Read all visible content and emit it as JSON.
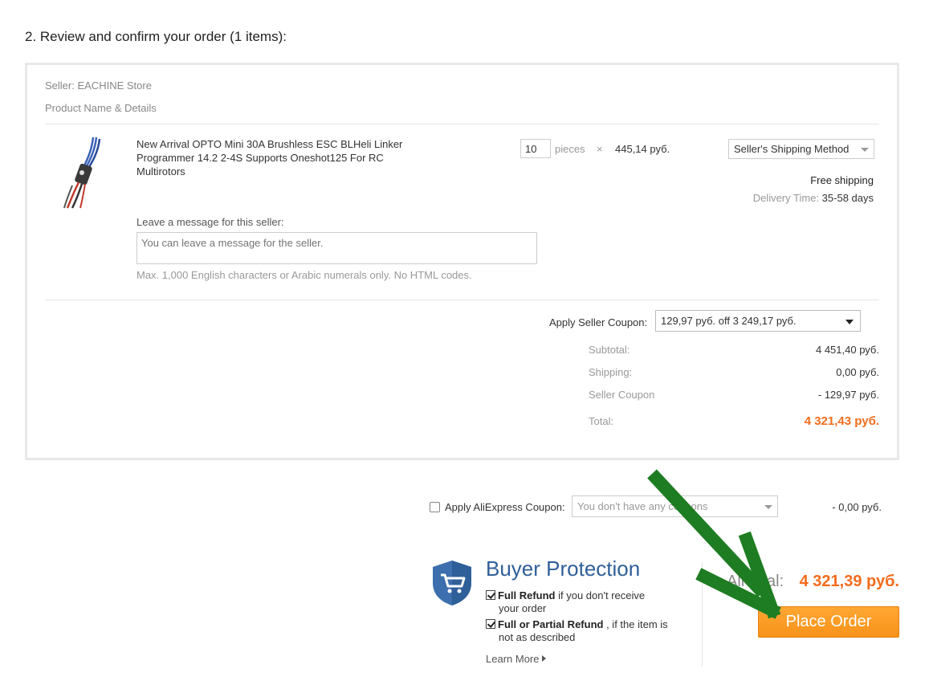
{
  "section_title": "2. Review and confirm your order (1 items):",
  "seller": {
    "label": "Seller: EACHINE Store",
    "product_header": "Product Name & Details"
  },
  "product": {
    "name": "New Arrival OPTO Mini 30A Brushless ESC BLHeli Linker Programmer 14.2 2-4S Supports Oneshot125 For RC Multirotors",
    "quantity": "10",
    "unit": "pieces",
    "times": "×",
    "unit_price": "445,14 руб.",
    "shipping_method": "Seller's Shipping Method",
    "free_shipping": "Free shipping",
    "delivery_label": "Delivery Time:",
    "delivery_value": "35-58 days"
  },
  "message": {
    "label": "Leave a message for this seller:",
    "placeholder": "You can leave a message for the seller.",
    "hint": "Max. 1,000 English characters or Arabic numerals only. No HTML codes."
  },
  "seller_coupon": {
    "label": "Apply Seller Coupon:",
    "selected": "129,97 руб. off 3 249,17 руб."
  },
  "summary": {
    "subtotal_label": "Subtotal:",
    "subtotal_value": "4 451,40 руб.",
    "shipping_label": "Shipping:",
    "shipping_value": "0,00 руб.",
    "coupon_label": "Seller Coupon",
    "coupon_value": "- 129,97 руб.",
    "total_label": "Total:",
    "total_value": "4 321,43 руб."
  },
  "ali_coupon": {
    "label": "Apply AliExpress Coupon:",
    "placeholder": "You don't have any coupons",
    "value": "- 0,00 руб."
  },
  "buyer_protection": {
    "title": "Buyer Protection",
    "line1_bold": "Full Refund",
    "line1_rest": " if you don't receive",
    "line1_sub": "your order",
    "line2_bold": "Full or Partial Refund",
    "line2_rest": " , if the item is",
    "line2_sub": "not as described",
    "learn_more": "Learn More"
  },
  "grand_total": {
    "label": "All total:",
    "value": "4 321,39 руб."
  },
  "place_order_label": "Place Order",
  "colors": {
    "accent_orange": "#f46c1d",
    "button_orange": "#f7921a",
    "protection_blue": "#2f5f99",
    "annotation_green": "#1e7d22"
  }
}
